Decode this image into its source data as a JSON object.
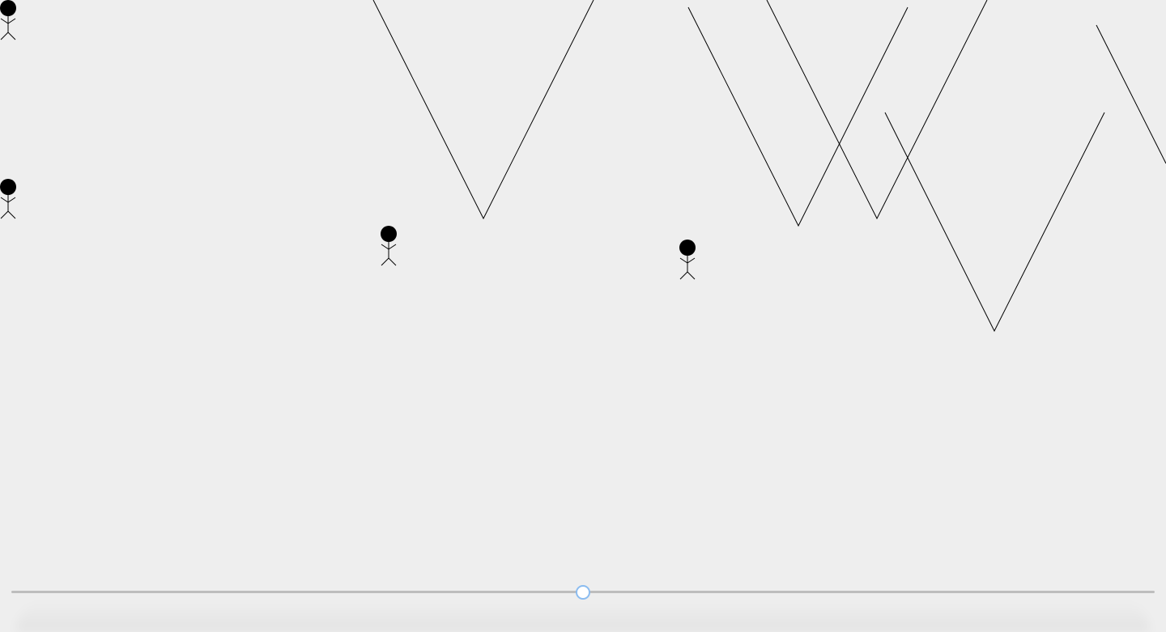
{
  "scene": {
    "stick_figures": 4,
    "zigzag_lines": 5,
    "line_color": "#000000",
    "background_color": "#eeeeee"
  },
  "slider": {
    "value_fraction": 0.5,
    "track_color": "#bdbdbd",
    "thumb_border_color": "#8bbcf0"
  }
}
